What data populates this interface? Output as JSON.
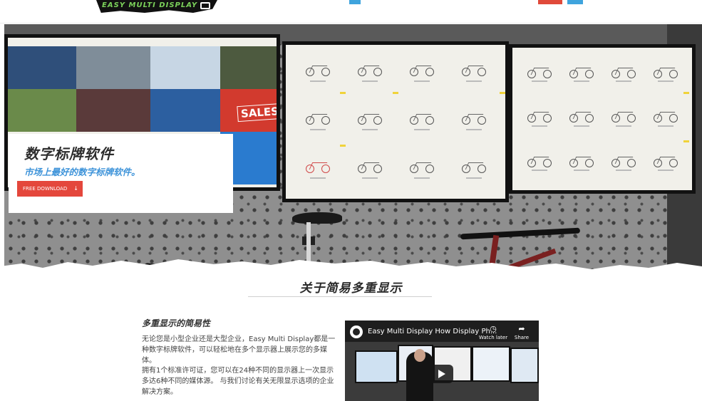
{
  "header": {
    "logo_text": "EASY MULTI DISPLAY"
  },
  "hero": {
    "title": "数字标牌软件",
    "subtitle": "市场上最好的数字标牌软件。",
    "download_label": "FREE DOWNLOAD",
    "download_icon": "arrow-down-icon",
    "sales_label": "SALES"
  },
  "about": {
    "section_title": "关于简易多重显示",
    "heading": "多重显示的简易性",
    "paragraph1": "无论您是小型企业还是大型企业，Easy Multi Display都是一种数字标牌软件，可以轻松地在多个显示器上展示您的多媒体。",
    "paragraph2": "拥有1个标准许可证，您可以在24种不同的显示器上一次显示多达6种不同的媒体源。 与我们讨论有关无限显示选项的企业解决方案。"
  },
  "video": {
    "title": "Easy Multi Display How Display Ph...",
    "watch_later": "Watch later",
    "share": "Share"
  },
  "colors": {
    "accent_red": "#e4473c",
    "accent_blue": "#3d93d9"
  }
}
